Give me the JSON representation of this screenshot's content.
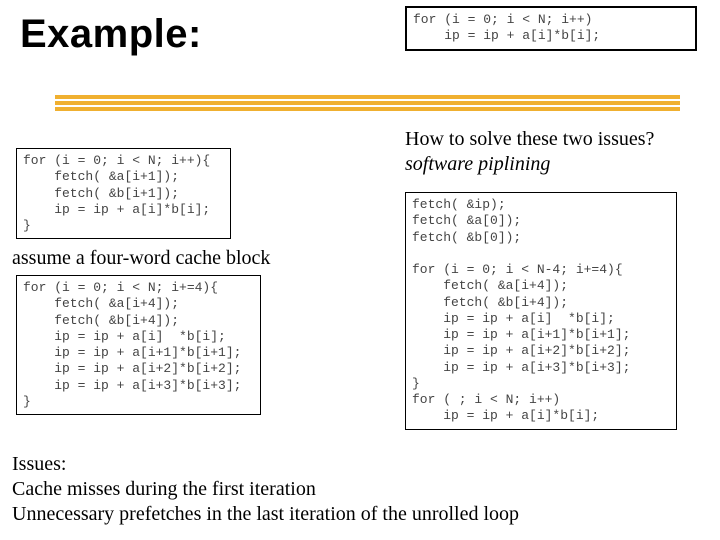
{
  "title": "Example:",
  "code_top_right": "for (i = 0; i < N; i++)\n    ip = ip + a[i]*b[i];",
  "code_left_1": "for (i = 0; i < N; i++){\n    fetch( &a[i+1]);\n    fetch( &b[i+1]);\n    ip = ip + a[i]*b[i];\n}",
  "label_assume": "assume a four-word cache block",
  "code_left_2": "for (i = 0; i < N; i+=4){\n    fetch( &a[i+4]);\n    fetch( &b[i+4]);\n    ip = ip + a[i]  *b[i];\n    ip = ip + a[i+1]*b[i+1];\n    ip = ip + a[i+2]*b[i+2];\n    ip = ip + a[i+3]*b[i+3];\n}",
  "q_line1": "How to solve these two issues?",
  "q_line2": "software piplining",
  "code_right": "fetch( &ip);\nfetch( &a[0]);\nfetch( &b[0]);\n\nfor (i = 0; i < N-4; i+=4){\n    fetch( &a[i+4]);\n    fetch( &b[i+4]);\n    ip = ip + a[i]  *b[i];\n    ip = ip + a[i+1]*b[i+1];\n    ip = ip + a[i+2]*b[i+2];\n    ip = ip + a[i+3]*b[i+3];\n}\nfor ( ; i < N; i++)\n    ip = ip + a[i]*b[i];",
  "issues_l1": "Issues:",
  "issues_l2": "Cache misses during the first iteration",
  "issues_l3": "Unnecessary prefetches in the last iteration of the unrolled loop"
}
